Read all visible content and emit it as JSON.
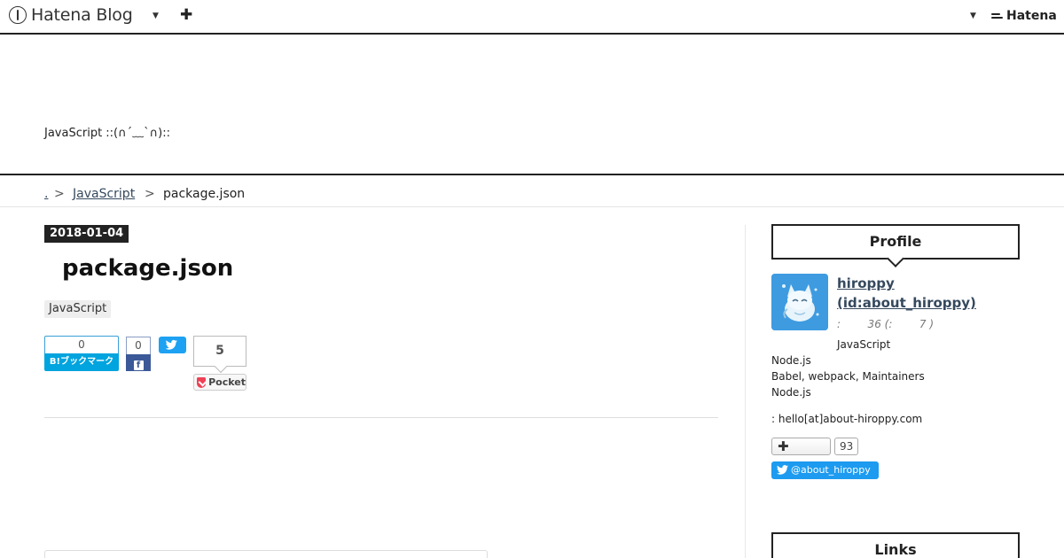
{
  "global_header": {
    "logo_text": "Hatena Blog",
    "hatena_text": "Hatena"
  },
  "blog": {
    "description": "JavaScript ::(∩´﹏`∩)::"
  },
  "breadcrumb": {
    "home": ".",
    "sep": ">",
    "category": "JavaScript",
    "current": "package.json"
  },
  "entry": {
    "date": "2018-01-04",
    "title": "package.json",
    "category": "JavaScript",
    "share": {
      "hatena_count": "0",
      "hatena_label": "B!ブックマーク",
      "facebook_count": "0",
      "pocket_count": "5",
      "pocket_label": "Pocket"
    }
  },
  "sidebar": {
    "profile_title": "Profile",
    "name_line1": "hiroppy",
    "name_line2": "(id:about_hiroppy)",
    "meta": ":        36 (:        7 )",
    "lines": [
      "JavaScript",
      "Node.js",
      "Babel, webpack, Maintainers",
      "Node.js"
    ],
    "contact": ": hello[at]about-hiroppy.com",
    "follow_count": "93",
    "twitter_label": "@about_hiroppy",
    "links_title": "Links"
  },
  "colors": {
    "hatena_bookmark": "#00a4de",
    "facebook": "#3b5998",
    "twitter": "#1da1f2",
    "pocket": "#ef4056",
    "link": "#35495e"
  }
}
